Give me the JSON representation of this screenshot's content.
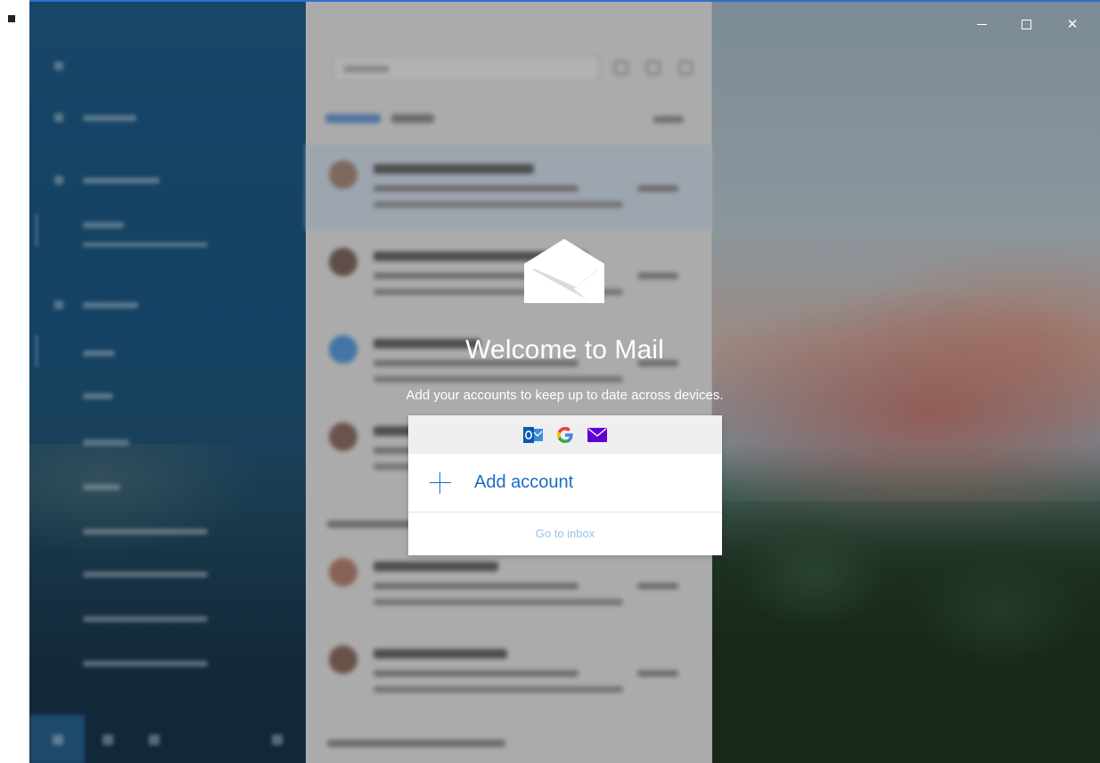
{
  "window": {
    "controls": {
      "minimize": "minimize",
      "maximize": "maximize",
      "close": "✕"
    }
  },
  "welcome": {
    "title": "Welcome to Mail",
    "subtitle": "Add your accounts to keep up to date across devices.",
    "providers": [
      "outlook-icon",
      "google-icon",
      "yahoo-mail-icon"
    ],
    "add_account_label": "Add account",
    "go_to_inbox_label": "Go to inbox"
  },
  "colors": {
    "accent": "#1a6ec2",
    "inbox_link": "#9cc0e4",
    "titlebar_border": "#2f6fd0"
  }
}
